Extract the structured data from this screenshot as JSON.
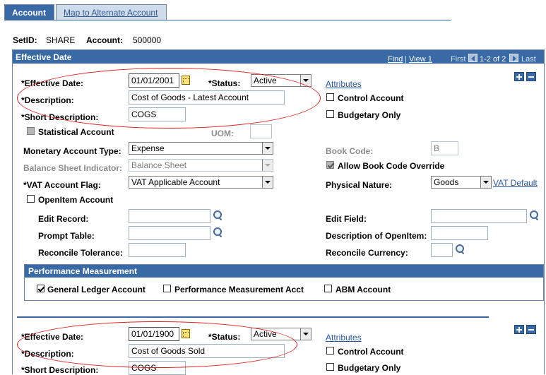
{
  "tabs": [
    {
      "label": "Account",
      "active": true
    },
    {
      "label": "Map to Alternate Account",
      "active": false
    }
  ],
  "header": {
    "setid_label": "SetID:",
    "setid_value": "SHARE",
    "account_label": "Account:",
    "account_value": "500000"
  },
  "panel": {
    "title": "Effective Date",
    "nav": {
      "find": "Find",
      "sep": "|",
      "view_all": "View 1",
      "first": "First",
      "position": "1-2 of 2",
      "last": "Last"
    }
  },
  "row1": {
    "eff_date_label": "*Effective Date:",
    "eff_date_value": "01/01/2001",
    "status_label": "*Status:",
    "status_value": "Active",
    "attributes_link": "Attributes",
    "description_label": "*Description:",
    "description_value": "Cost of Goods - Latest Account",
    "control_account_label": "Control Account",
    "short_desc_label": "*Short Description:",
    "short_desc_value": "COGS",
    "budgetary_only_label": "Budgetary Only",
    "statistical_account_label": "Statistical Account",
    "uom_label": "UOM:",
    "uom_value": "",
    "monetary_type_label": "Monetary Account Type:",
    "monetary_type_value": "Expense",
    "book_code_label": "Book Code:",
    "book_code_value": "B",
    "bs_indicator_label": "Balance Sheet Indicator:",
    "bs_indicator_value": "Balance Sheet",
    "allow_book_override_label": "Allow Book Code Override",
    "vat_flag_label": "*VAT Account Flag:",
    "vat_flag_value": "VAT Applicable Account",
    "physical_nature_label": "Physical Nature:",
    "physical_nature_value": "Goods",
    "vat_default_link": "VAT Default",
    "openitem_label": "OpenItem Account",
    "edit_record_label": "Edit Record:",
    "edit_record_value": "",
    "edit_field_label": "Edit Field:",
    "edit_field_value": "",
    "prompt_table_label": "Prompt Table:",
    "prompt_table_value": "",
    "desc_openitem_label": "Description of OpenItem:",
    "desc_openitem_value": "",
    "reconcile_tol_label": "Reconcile Tolerance:",
    "reconcile_tol_value": "",
    "reconcile_cur_label": "Reconcile Currency:",
    "reconcile_cur_value": ""
  },
  "performance": {
    "title": "Performance Measurement",
    "gl_account_label": "General Ledger Account",
    "pm_account_label": "Performance Measurement Acct",
    "abm_account_label": "ABM Account"
  },
  "row2": {
    "eff_date_label": "*Effective Date:",
    "eff_date_value": "01/01/1900",
    "status_label": "*Status:",
    "status_value": "Active",
    "attributes_link": "Attributes",
    "description_label": "*Description:",
    "description_value": "Cost of Goods Sold",
    "control_account_label": "Control Account",
    "short_desc_label": "*Short Description:",
    "short_desc_value": "COGS",
    "budgetary_only_label": "Budgetary Only"
  },
  "colors": {
    "header_blue": "#3a6aa5",
    "annotation_red": "#e02020",
    "link_blue": "#2a58a3"
  }
}
